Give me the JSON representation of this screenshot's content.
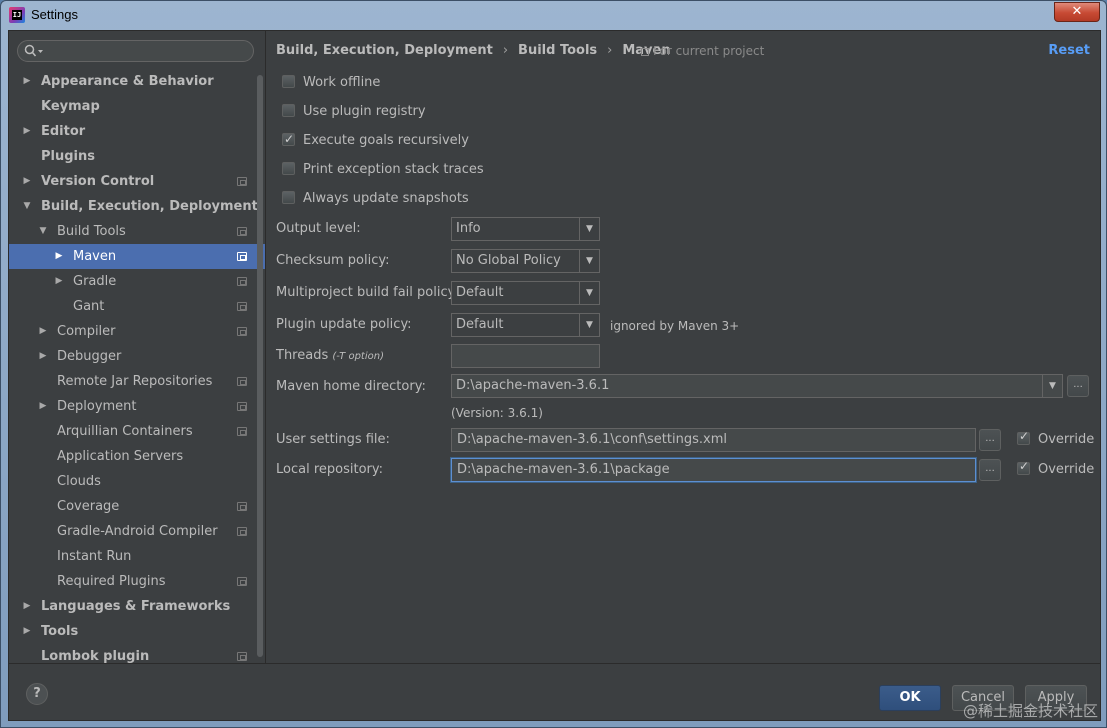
{
  "window": {
    "title": "Settings",
    "app_icon_text": "IJ",
    "close_label": "✕"
  },
  "search": {
    "placeholder": "",
    "value": ""
  },
  "sidebar": {
    "items": [
      {
        "label": "Appearance & Behavior",
        "bold": true,
        "level": 0,
        "arrow": "right",
        "project": false
      },
      {
        "label": "Keymap",
        "bold": true,
        "level": 0,
        "arrow": "",
        "project": false
      },
      {
        "label": "Editor",
        "bold": true,
        "level": 0,
        "arrow": "right",
        "project": false
      },
      {
        "label": "Plugins",
        "bold": true,
        "level": 0,
        "arrow": "",
        "project": false
      },
      {
        "label": "Version Control",
        "bold": true,
        "level": 0,
        "arrow": "right",
        "project": true
      },
      {
        "label": "Build, Execution, Deployment",
        "bold": true,
        "level": 0,
        "arrow": "down",
        "project": false
      },
      {
        "label": "Build Tools",
        "bold": false,
        "level": 1,
        "arrow": "down",
        "project": true
      },
      {
        "label": "Maven",
        "bold": false,
        "level": 2,
        "arrow": "right",
        "project": true,
        "selected": true
      },
      {
        "label": "Gradle",
        "bold": false,
        "level": 2,
        "arrow": "right",
        "project": true
      },
      {
        "label": "Gant",
        "bold": false,
        "level": 2,
        "arrow": "",
        "project": true
      },
      {
        "label": "Compiler",
        "bold": false,
        "level": 1,
        "arrow": "right",
        "project": true
      },
      {
        "label": "Debugger",
        "bold": false,
        "level": 1,
        "arrow": "right",
        "project": false
      },
      {
        "label": "Remote Jar Repositories",
        "bold": false,
        "level": 1,
        "arrow": "",
        "project": true
      },
      {
        "label": "Deployment",
        "bold": false,
        "level": 1,
        "arrow": "right",
        "project": true
      },
      {
        "label": "Arquillian Containers",
        "bold": false,
        "level": 1,
        "arrow": "",
        "project": true
      },
      {
        "label": "Application Servers",
        "bold": false,
        "level": 1,
        "arrow": "",
        "project": false
      },
      {
        "label": "Clouds",
        "bold": false,
        "level": 1,
        "arrow": "",
        "project": false
      },
      {
        "label": "Coverage",
        "bold": false,
        "level": 1,
        "arrow": "",
        "project": true
      },
      {
        "label": "Gradle-Android Compiler",
        "bold": false,
        "level": 1,
        "arrow": "",
        "project": true
      },
      {
        "label": "Instant Run",
        "bold": false,
        "level": 1,
        "arrow": "",
        "project": false
      },
      {
        "label": "Required Plugins",
        "bold": false,
        "level": 1,
        "arrow": "",
        "project": true
      },
      {
        "label": "Languages & Frameworks",
        "bold": true,
        "level": 0,
        "arrow": "right",
        "project": false
      },
      {
        "label": "Tools",
        "bold": true,
        "level": 0,
        "arrow": "right",
        "project": false
      },
      {
        "label": "Lombok plugin",
        "bold": true,
        "level": 0,
        "arrow": "",
        "project": true
      }
    ]
  },
  "header": {
    "crumb1": "Build, Execution, Deployment",
    "crumb2": "Build Tools",
    "crumb3": "Maven",
    "sep": "›",
    "for_project": "For current project",
    "reset": "Reset"
  },
  "checks": {
    "work_offline": {
      "label": "Work offline",
      "checked": false
    },
    "plugin_registry": {
      "label": "Use plugin registry",
      "checked": false
    },
    "goals_recursive": {
      "label": "Execute goals recursively",
      "checked": true
    },
    "stack_traces": {
      "label": "Print exception stack traces",
      "checked": false
    },
    "update_snapshots": {
      "label": "Always update snapshots",
      "checked": false
    }
  },
  "form": {
    "output_level": {
      "label": "Output level:",
      "value": "Info"
    },
    "checksum": {
      "label": "Checksum policy:",
      "value": "No Global Policy"
    },
    "multiproject": {
      "label": "Multiproject build fail policy:",
      "value": "Default"
    },
    "plugin_update": {
      "label": "Plugin update policy:",
      "value": "Default",
      "note": "ignored by Maven 3+"
    },
    "threads": {
      "label": "Threads",
      "hint": "(-T option)",
      "value": ""
    },
    "maven_home": {
      "label": "Maven home directory:",
      "value": "D:\\apache-maven-3.6.1",
      "version": "(Version: 3.6.1)"
    },
    "user_settings": {
      "label": "User settings file:",
      "value": "D:\\apache-maven-3.6.1\\conf\\settings.xml",
      "override": "Override",
      "override_checked": true
    },
    "local_repo": {
      "label": "Local repository:",
      "value": "D:\\apache-maven-3.6.1\\package",
      "override": "Override",
      "override_checked": true
    },
    "browse": "..."
  },
  "footer": {
    "help": "?",
    "ok": "OK",
    "cancel": "Cancel",
    "apply": "Apply"
  },
  "watermark": "@稀土掘金技术社区",
  "colors": {
    "background": "#3c3f41",
    "selection": "#4b6eaf",
    "link": "#589df6",
    "ok_button": "#365880"
  }
}
